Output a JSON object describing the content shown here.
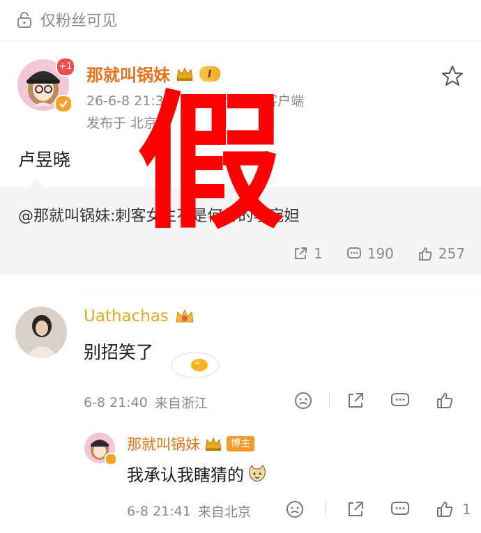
{
  "visibility": {
    "label": "仅粉丝可见"
  },
  "post": {
    "author": "那就叫锅妹",
    "vip_level": "I",
    "avatar_badge": "+1",
    "timestamp": "26-6-8 21:32",
    "source": "来自 iPhone 客户端",
    "location": "发布于 北京",
    "text": "卢昱晓",
    "overlay_char": "假"
  },
  "repost": {
    "text": "@那就叫锅妹:刺客女主不是何传的李宛妲",
    "shares": "1",
    "comments": "190",
    "likes": "257"
  },
  "comment": {
    "author": "Uathachas",
    "text": "别招笑了",
    "time": "6-8 21:40",
    "location": "来自浙江"
  },
  "reply": {
    "author": "那就叫锅妹",
    "badge": "博主",
    "text": "我承认我瞎猜的",
    "time": "6-8 21:41",
    "location": "来自北京",
    "likes": "1"
  },
  "colors": {
    "author_orange": "#e8731a",
    "gold": "#e5a91f",
    "overlay_red": "#ff0000",
    "repost_bg": "#f5f5f5"
  }
}
